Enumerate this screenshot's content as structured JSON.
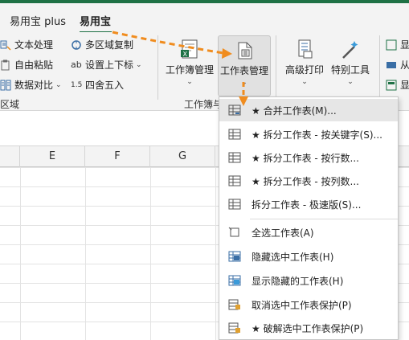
{
  "tabs": [
    {
      "label": "易用宝 plus"
    },
    {
      "label": "易用宝"
    }
  ],
  "ribbon": {
    "left_items": [
      {
        "label": "文本处理"
      },
      {
        "label": "自由粘贴"
      },
      {
        "label": "数据对比"
      },
      {
        "label": "多区域复制"
      },
      {
        "label": "设置上下标"
      },
      {
        "label": "四舍五入"
      }
    ],
    "left_group_label": "区域",
    "workbook_btn": "工作簿管理",
    "sheet_btn": "工作表管理",
    "group_label_wb": "工作簿与",
    "print_btn": "高级打印",
    "special_btn": "特别工具",
    "right_partial": [
      "显",
      "从",
      "显"
    ]
  },
  "columns": [
    "E",
    "F",
    "G"
  ],
  "menu": {
    "items": [
      {
        "label": "★ 合并工作表(M)...",
        "icon": "merge-sheets-icon"
      },
      {
        "label": "★ 拆分工作表 - 按关键字(S)...",
        "icon": "split-sheet-icon"
      },
      {
        "label": "★ 拆分工作表 - 按行数...",
        "icon": "split-sheet-icon"
      },
      {
        "label": "★ 拆分工作表 - 按列数...",
        "icon": "split-sheet-icon"
      },
      {
        "label": "拆分工作表 - 极速版(S)...",
        "icon": "split-sheet-icon"
      },
      {
        "label": "全选工作表(A)",
        "icon": "select-all-sheets-icon"
      },
      {
        "label": "隐藏选中工作表(H)",
        "icon": "hide-sheets-icon"
      },
      {
        "label": "显示隐藏的工作表(H)",
        "icon": "unhide-sheets-icon"
      },
      {
        "label": "取消选中工作表保护(P)",
        "icon": "unprotect-sheet-icon"
      },
      {
        "label": "★ 破解选中工作表保护(P)",
        "icon": "crack-protection-icon"
      }
    ]
  },
  "colors": {
    "accent": "#1e7145",
    "arrow": "#f08c1e",
    "ribbon_bg": "#f3f3f3"
  }
}
